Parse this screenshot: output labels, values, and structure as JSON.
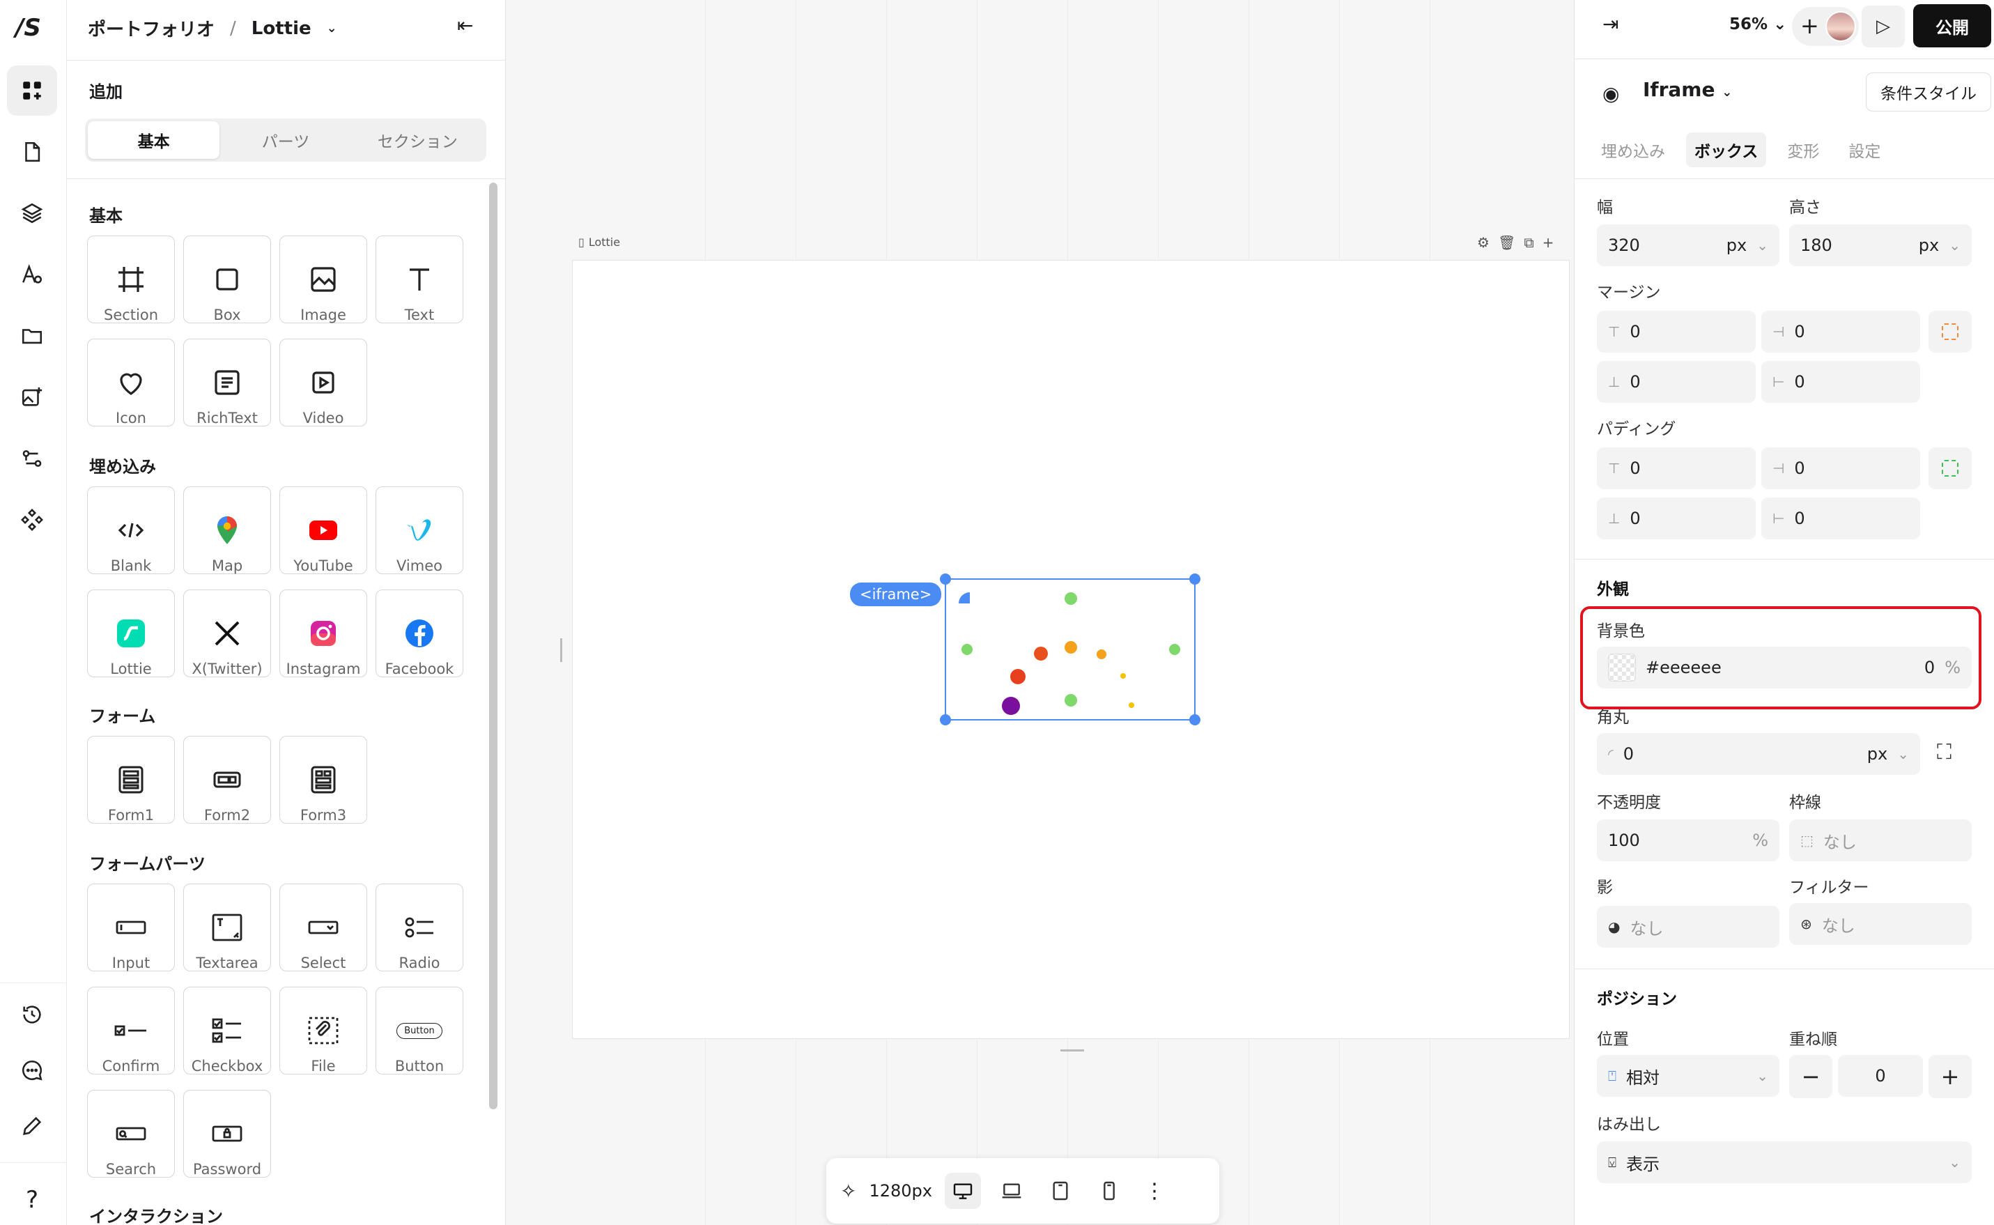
{
  "rail": {
    "logo": "/S",
    "items": [
      "add-elements",
      "pages",
      "layers",
      "typography",
      "folder",
      "media",
      "logic",
      "components"
    ],
    "bottom": [
      "history",
      "comments",
      "edit",
      "help"
    ],
    "help_label": "?"
  },
  "add_panel": {
    "breadcrumb_root": "ポートフォリオ",
    "breadcrumb_sep": "/",
    "breadcrumb_page": "Lottie",
    "title": "追加",
    "tabs": [
      "基本",
      "パーツ",
      "セクション"
    ],
    "sections": {
      "basic": "基本",
      "embed": "埋め込み",
      "form": "フォーム",
      "form_parts": "フォームパーツ",
      "interaction": "インタラクション"
    },
    "basic_items": [
      "Section",
      "Box",
      "Image",
      "Text",
      "Icon",
      "RichText",
      "Video"
    ],
    "embed_items": [
      "Blank",
      "Map",
      "YouTube",
      "Vimeo",
      "Lottie",
      "X(Twitter)",
      "Instagram",
      "Facebook"
    ],
    "form_items": [
      "Form1",
      "Form2",
      "Form3"
    ],
    "form_part_items": [
      "Input",
      "Textarea",
      "Select",
      "Radio",
      "Confirm",
      "Checkbox",
      "File",
      "Button",
      "Search",
      "Password"
    ],
    "button_tile_text": "Button"
  },
  "canvas": {
    "frame_label": "Lottie",
    "iframe_tag": "<iframe>",
    "width_label": "1280px",
    "dot_colors": [
      "#7ed86a",
      "#e8501e",
      "#f5a11c",
      "#f5c400",
      "#7a0f9e",
      "#4a8cf3"
    ]
  },
  "right_panel": {
    "zoom": "56%",
    "publish": "公開",
    "element_name": "Iframe",
    "conditional_style": "条件スタイル",
    "tabs": [
      "埋め込み",
      "ボックス",
      "変形",
      "設定"
    ],
    "width_label": "幅",
    "width_value": "320",
    "width_unit": "px",
    "height_label": "高さ",
    "height_value": "180",
    "height_unit": "px",
    "margin_label": "マージン",
    "margin_top": "0",
    "margin_right": "0",
    "margin_bottom": "0",
    "margin_left": "0",
    "padding_label": "パディング",
    "padding_top": "0",
    "padding_right": "0",
    "padding_bottom": "0",
    "padding_left": "0",
    "appearance_title": "外観",
    "bg_label": "背景色",
    "bg_value": "#eeeeee",
    "bg_opacity": "0",
    "bg_opacity_unit": "%",
    "radius_label": "角丸",
    "radius_value": "0",
    "radius_unit": "px",
    "opacity_label": "不透明度",
    "opacity_value": "100",
    "opacity_unit": "%",
    "border_label": "枠線",
    "border_value": "なし",
    "shadow_label": "影",
    "shadow_value": "なし",
    "filter_label": "フィルター",
    "filter_value": "なし",
    "position_title": "ポジション",
    "position_label": "位置",
    "position_value": "相対",
    "z_label": "重ね順",
    "z_value": "0",
    "overflow_label": "はみ出し",
    "overflow_value": "表示"
  }
}
